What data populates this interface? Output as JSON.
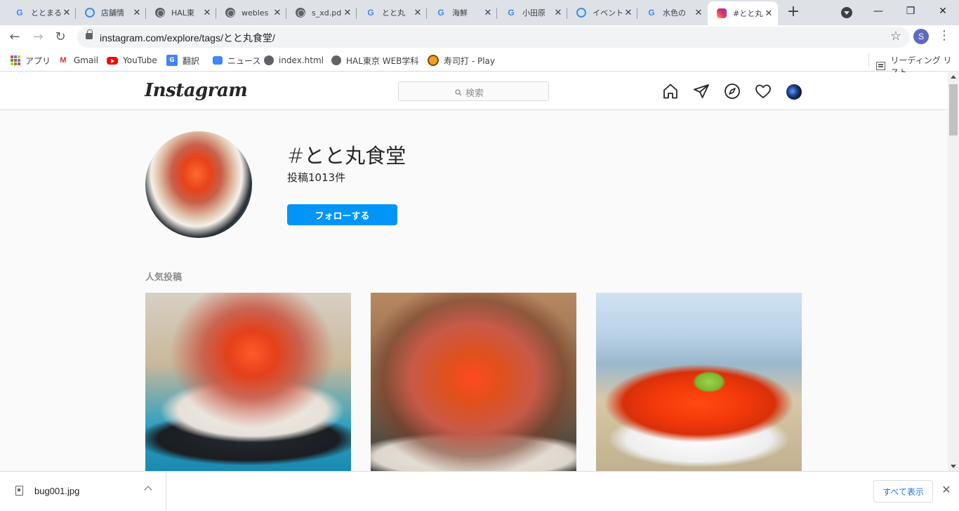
{
  "browser": {
    "tabs": [
      {
        "title": "ととまる",
        "favicon": "google-g"
      },
      {
        "title": "店舗情",
        "favicon": "hal-globe"
      },
      {
        "title": "HAL東",
        "favicon": "globe"
      },
      {
        "title": "webles",
        "favicon": "globe"
      },
      {
        "title": "s_xd.pd",
        "favicon": "globe"
      },
      {
        "title": "とと丸",
        "favicon": "google-g"
      },
      {
        "title": "海鮮",
        "favicon": "google-g"
      },
      {
        "title": "小田原",
        "favicon": "google-g"
      },
      {
        "title": "イベント",
        "favicon": "hal-globe"
      },
      {
        "title": "水色の",
        "favicon": "google-g"
      },
      {
        "title": "#とと丸",
        "favicon": "instagram",
        "active": true
      }
    ],
    "url": "instagram.com/explore/tags/とと丸食堂/",
    "profile_initial": "S",
    "bookmarks": [
      {
        "label": "アプリ",
        "icon": "apps-grid-icon"
      },
      {
        "label": "Gmail",
        "icon": "gmail-icon"
      },
      {
        "label": "YouTube",
        "icon": "youtube-icon"
      },
      {
        "label": "翻訳",
        "icon": "translate-icon"
      },
      {
        "label": "ニュース",
        "icon": "news-icon"
      },
      {
        "label": "index.html",
        "icon": "globe-icon"
      },
      {
        "label": "HAL東京 WEB学科",
        "icon": "globe-icon"
      },
      {
        "label": "寿司打 - Play",
        "icon": "sushida-icon"
      }
    ],
    "reading_list": "リーディング リスト"
  },
  "instagram": {
    "logo": "Instagram",
    "search_placeholder": "検索",
    "hashtag": "#とと丸食堂",
    "post_count": "投稿1013件",
    "follow_label": "フォローする",
    "section_label": "人気投稿"
  },
  "downloads": {
    "file_name": "bug001.jpg",
    "show_all": "すべて表示"
  },
  "colors": {
    "follow_button": "#0095f6",
    "tab_strip": "#dee1e6"
  }
}
